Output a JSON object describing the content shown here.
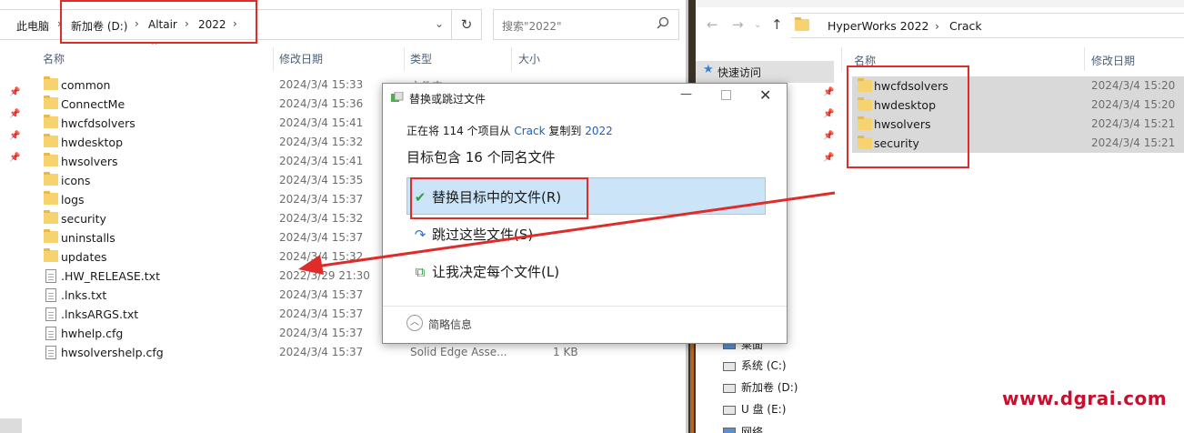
{
  "left": {
    "breadcrumb": [
      "此电脑",
      "新加卷 (D:)",
      "Altair",
      "2022"
    ],
    "search_placeholder": "搜索\"2022\"",
    "columns": {
      "name": "名称",
      "date": "修改日期",
      "type": "类型",
      "size": "大小"
    },
    "rows": [
      {
        "name": "common",
        "date": "2024/3/4 15:33",
        "type": "文件夹",
        "size": "",
        "kind": "folder"
      },
      {
        "name": "ConnectMe",
        "date": "2024/3/4 15:36",
        "type": "",
        "size": "",
        "kind": "folder"
      },
      {
        "name": "hwcfdsolvers",
        "date": "2024/3/4 15:41",
        "type": "",
        "size": "",
        "kind": "folder"
      },
      {
        "name": "hwdesktop",
        "date": "2024/3/4 15:32",
        "type": "",
        "size": "",
        "kind": "folder"
      },
      {
        "name": "hwsolvers",
        "date": "2024/3/4 15:41",
        "type": "",
        "size": "",
        "kind": "folder"
      },
      {
        "name": "icons",
        "date": "2024/3/4 15:35",
        "type": "",
        "size": "",
        "kind": "folder"
      },
      {
        "name": "logs",
        "date": "2024/3/4 15:37",
        "type": "",
        "size": "",
        "kind": "folder"
      },
      {
        "name": "security",
        "date": "2024/3/4 15:32",
        "type": "",
        "size": "",
        "kind": "folder"
      },
      {
        "name": "uninstalls",
        "date": "2024/3/4 15:37",
        "type": "",
        "size": "",
        "kind": "folder"
      },
      {
        "name": "updates",
        "date": "2024/3/4 15:32",
        "type": "",
        "size": "",
        "kind": "folder"
      },
      {
        "name": ".HW_RELEASE.txt",
        "date": "2022/3/29 21:30",
        "type": "",
        "size": "",
        "kind": "file"
      },
      {
        "name": ".lnks.txt",
        "date": "2024/3/4 15:37",
        "type": "",
        "size": "",
        "kind": "file"
      },
      {
        "name": ".lnksARGS.txt",
        "date": "2024/3/4 15:37",
        "type": "",
        "size": "",
        "kind": "file"
      },
      {
        "name": "hwhelp.cfg",
        "date": "2024/3/4 15:37",
        "type": "",
        "size": "",
        "kind": "file"
      },
      {
        "name": "hwsolvershelp.cfg",
        "date": "2024/3/4 15:37",
        "type": "Solid Edge Asse...",
        "size": "1 KB",
        "kind": "file"
      }
    ]
  },
  "right": {
    "breadcrumb": [
      "HyperWorks 2022",
      "Crack"
    ],
    "columns": {
      "name": "名称",
      "date": "修改日期"
    },
    "nav": {
      "quick_access": "快速访问",
      "drives": [
        "桌面",
        "系统 (C:)",
        "新加卷 (D:)",
        "U 盘 (E:)",
        "网络"
      ]
    },
    "rows": [
      {
        "name": "hwcfdsolvers",
        "date": "2024/3/4 15:20"
      },
      {
        "name": "hwdesktop",
        "date": "2024/3/4 15:20"
      },
      {
        "name": "hwsolvers",
        "date": "2024/3/4 15:21"
      },
      {
        "name": "security",
        "date": "2024/3/4 15:21"
      }
    ]
  },
  "dialog": {
    "title": "替换或跳过文件",
    "desc_prefix": "正在将 114 个项目从 ",
    "source": "Crack",
    "desc_mid": " 复制到 ",
    "dest": "2022",
    "heading": "目标包含 16 个同名文件",
    "options": {
      "replace": "替换目标中的文件(R)",
      "skip": "跳过这些文件(S)",
      "decide": "让我决定每个文件(L)"
    },
    "details": "简略信息"
  },
  "watermark": "www.dgrai.com",
  "colors": {
    "annotation_red": "#e02b2b",
    "selection_blue": "#cce4f7",
    "folder_yellow": "#f7d36f",
    "link_blue": "#1f5fbf"
  }
}
